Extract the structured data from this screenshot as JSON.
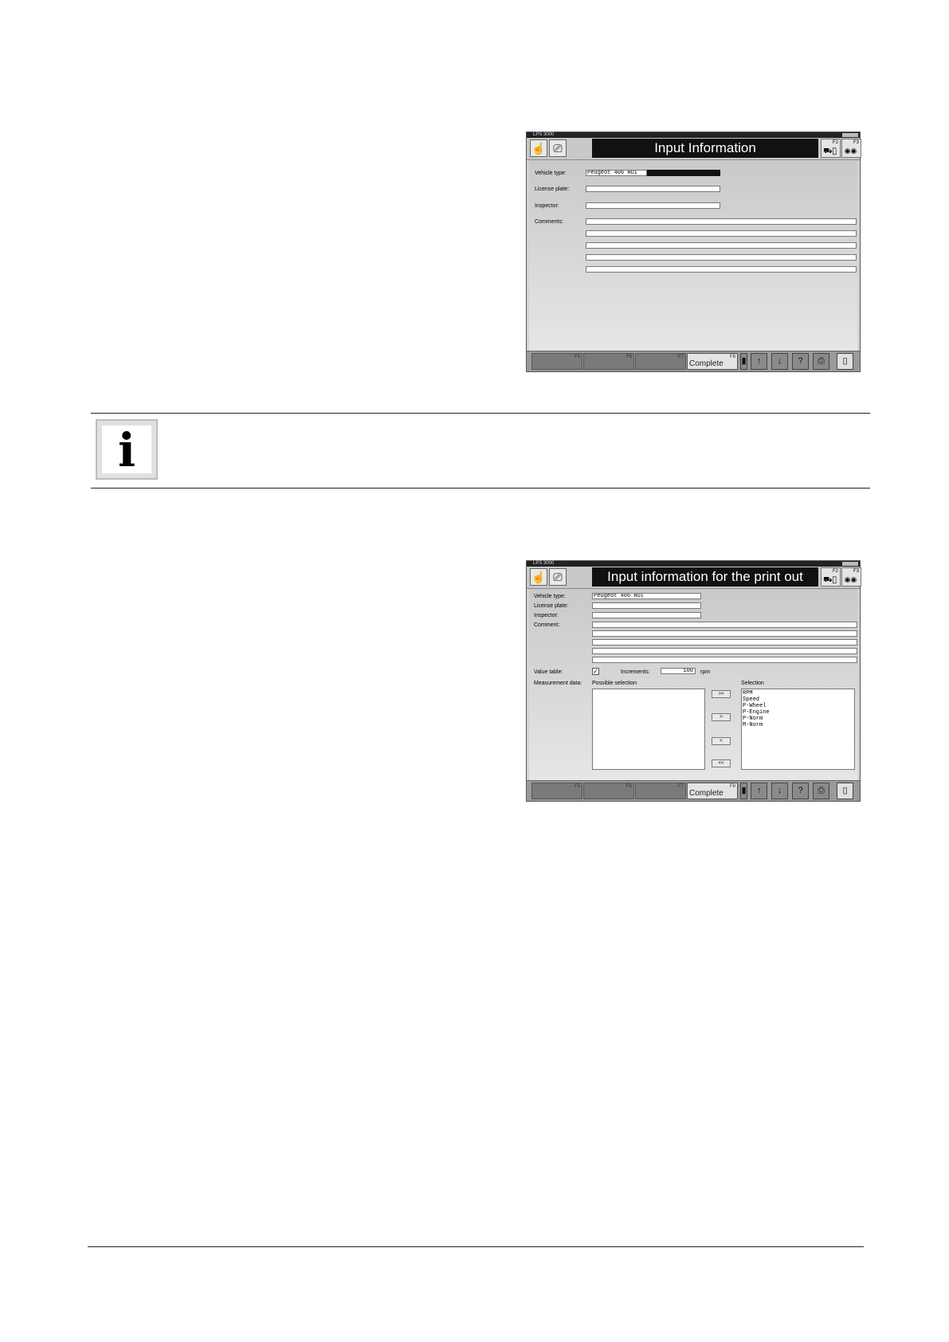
{
  "window1": {
    "titlebar": "LPS 3000",
    "header": "Input Information",
    "fkeys": [
      {
        "key": "F2",
        "icon": "⛟▯"
      },
      {
        "key": "F3",
        "icon": "◉◉"
      }
    ],
    "fields": [
      {
        "label": "Vehicle type:",
        "value": "Peugeot 406 HDI"
      },
      {
        "label": "License plate:",
        "value": ""
      },
      {
        "label": "Inspector:",
        "value": ""
      },
      {
        "label": "Comments:",
        "value": ""
      }
    ],
    "bottom": {
      "keys": [
        "F5",
        "F6",
        "F7"
      ],
      "complete_key": "F8",
      "complete_label": "Complete"
    }
  },
  "window2": {
    "titlebar": "LPS 3000",
    "header": "Input information for the print out",
    "fkeys": [
      {
        "key": "F2",
        "icon": "⛟▯"
      },
      {
        "key": "F3",
        "icon": "◉◉"
      }
    ],
    "fields": [
      {
        "label": "Vehicle type:",
        "value": "Peugeot 406 HDI"
      },
      {
        "label": "License plate:",
        "value": ""
      },
      {
        "label": "Inspector:",
        "value": ""
      },
      {
        "label": "Comment:",
        "value": ""
      }
    ],
    "value_table_label": "Value table:",
    "value_table_checked": true,
    "increments_label": "Increments:",
    "increments_value": "100",
    "increments_unit": "rpm",
    "measurement_label": "Measurement data:",
    "possible_label": "Possible selection",
    "selection_label": "Selection",
    "move_buttons": [
      ">>",
      ">",
      "<",
      "<<"
    ],
    "selection_items": [
      "RPM",
      "Speed",
      "P-Wheel",
      "P-Engine",
      "P-Norm",
      "M-Norm"
    ],
    "bottom": {
      "keys": [
        "F5",
        "F6",
        "F7"
      ],
      "complete_key": "F8",
      "complete_label": "Complete"
    }
  },
  "info_icon": "i"
}
